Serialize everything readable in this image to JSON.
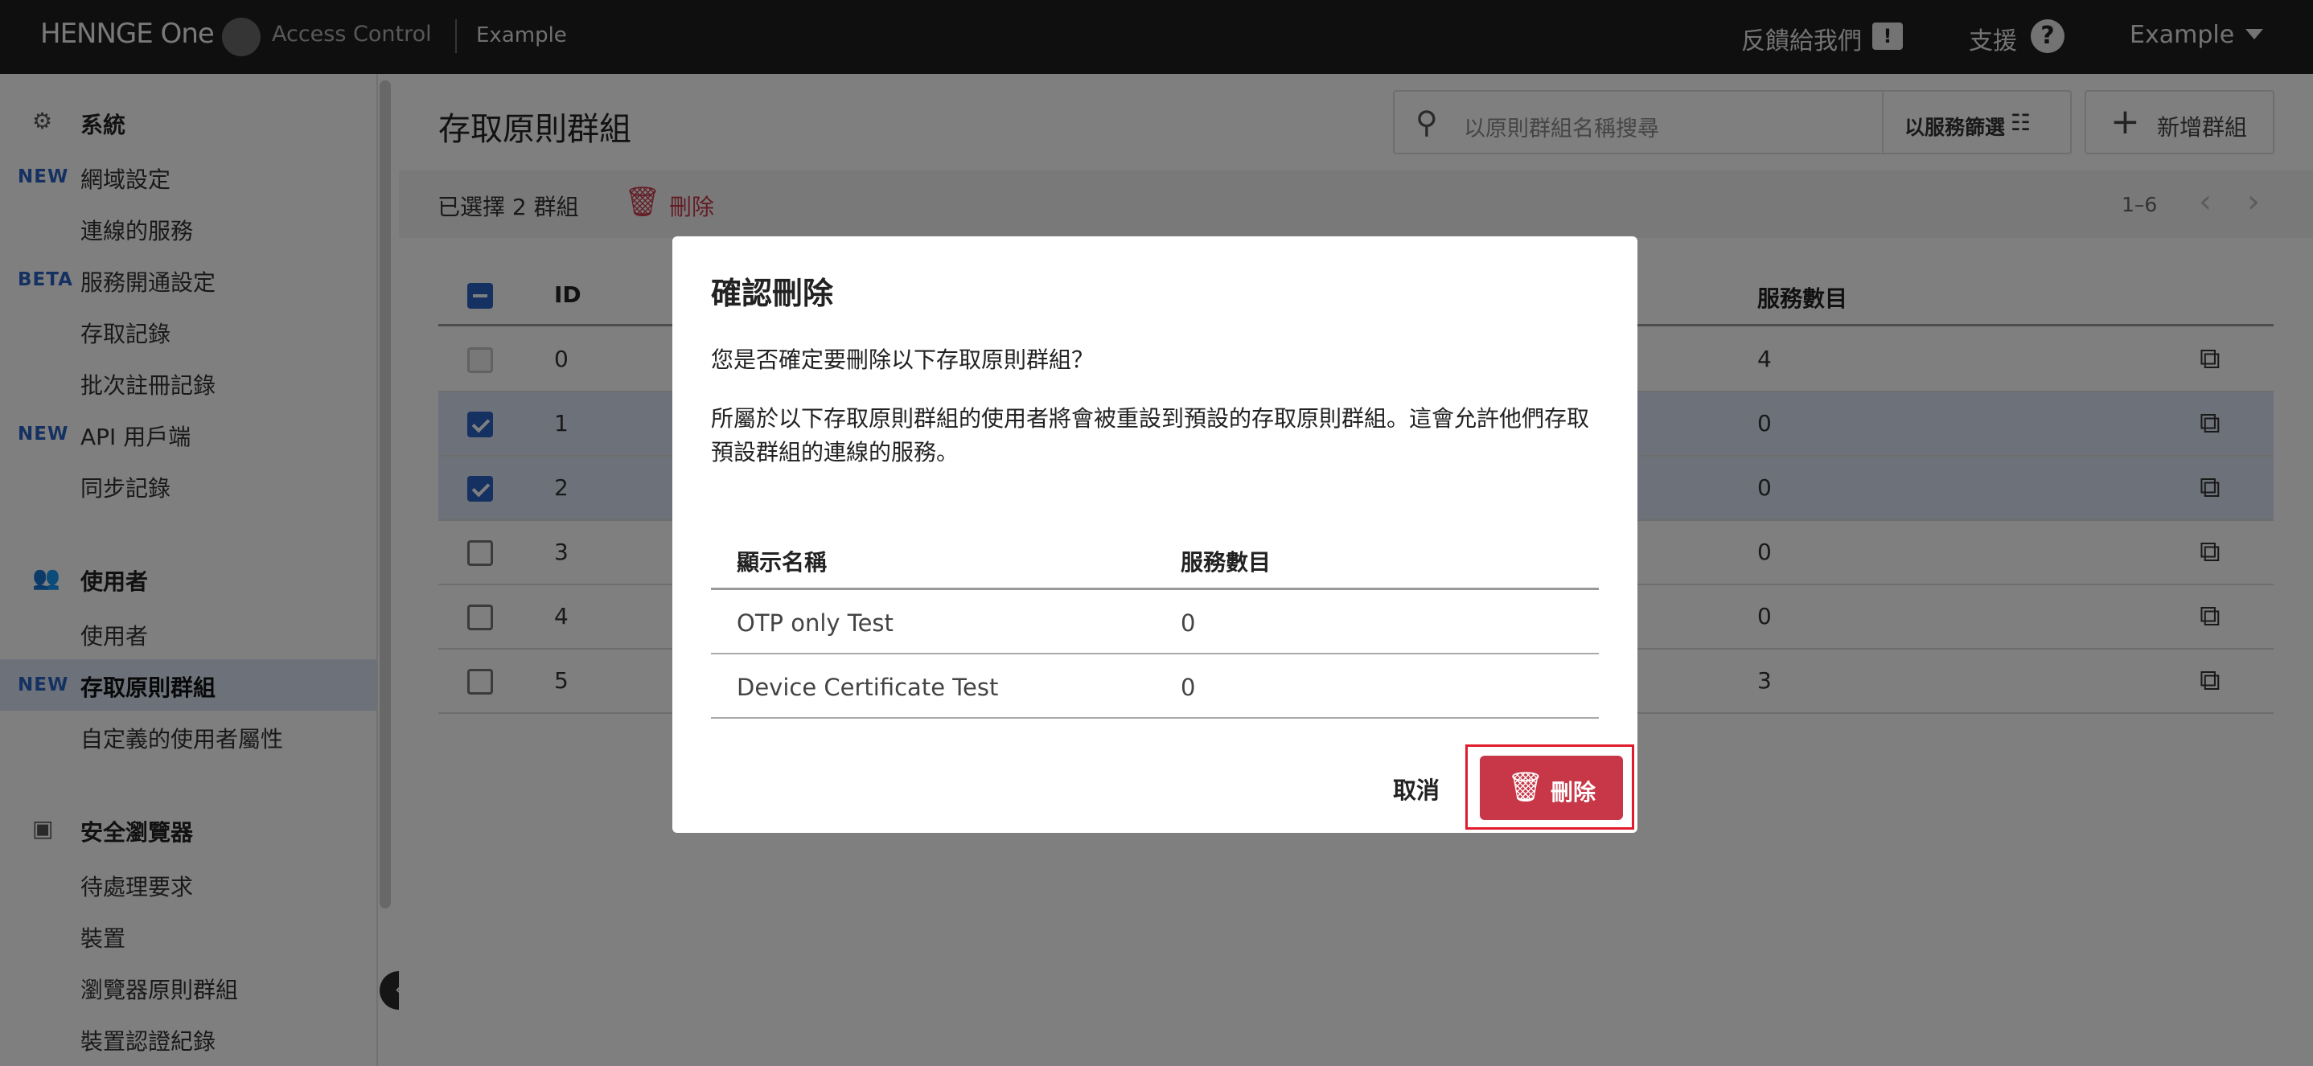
{
  "topbar": {
    "brand": "HENNGE One",
    "product": "Access Control",
    "tenant": "Example",
    "feedback_label": "反饋給我們",
    "support_label": "支援",
    "account_label": "Example"
  },
  "sidebar": {
    "sections": [
      {
        "title": "系統",
        "icon": "gear-icon"
      },
      {
        "title": "使用者",
        "icon": "users-icon"
      },
      {
        "title": "安全瀏覽器",
        "icon": "browser-icon"
      }
    ],
    "items": [
      {
        "tag": "NEW",
        "label": "網域設定"
      },
      {
        "tag": "",
        "label": "連線的服務"
      },
      {
        "tag": "BETA",
        "label": "服務開通設定"
      },
      {
        "tag": "",
        "label": "存取記錄"
      },
      {
        "tag": "",
        "label": "批次註冊記錄"
      },
      {
        "tag": "NEW",
        "label": "API 用戶端"
      },
      {
        "tag": "",
        "label": "同步記錄"
      },
      {
        "tag": "",
        "label": "使用者"
      },
      {
        "tag": "NEW",
        "label": "存取原則群組"
      },
      {
        "tag": "",
        "label": "自定義的使用者屬性"
      },
      {
        "tag": "",
        "label": "待處理要求"
      },
      {
        "tag": "",
        "label": "裝置"
      },
      {
        "tag": "",
        "label": "瀏覽器原則群組"
      },
      {
        "tag": "",
        "label": "裝置認證紀錄"
      }
    ],
    "active_item": "存取原則群組"
  },
  "main": {
    "title": "存取原則群組",
    "search_placeholder": "以原則群組名稱搜尋",
    "filter_label": "以服務篩選",
    "add_label": "新增群組",
    "selection_text": "已選擇 2 群組",
    "delete_label": "刪除",
    "pager": "1–6",
    "columns": {
      "id": "ID",
      "service_count": "服務數目"
    },
    "rows": [
      {
        "id": "0",
        "count": "4",
        "selected": false,
        "disabled": true
      },
      {
        "id": "1",
        "count": "0",
        "selected": true,
        "disabled": false
      },
      {
        "id": "2",
        "count": "0",
        "selected": true,
        "disabled": false
      },
      {
        "id": "3",
        "count": "0",
        "selected": false,
        "disabled": false
      },
      {
        "id": "4",
        "count": "0",
        "selected": false,
        "disabled": false
      },
      {
        "id": "5",
        "count": "3",
        "selected": false,
        "disabled": false
      }
    ]
  },
  "dialog": {
    "title": "確認刪除",
    "question": "您是否確定要刪除以下存取原則群組？",
    "description": "所屬於以下存取原則群組的使用者將會被重設到預設的存取原則群組。這會允許他們存取預設群組的連線的服務。",
    "columns": {
      "name": "顯示名稱",
      "count": "服務數目"
    },
    "rows": [
      {
        "name": "OTP only Test",
        "count": "0"
      },
      {
        "name": "Device Certificate Test",
        "count": "0"
      }
    ],
    "cancel_label": "取消",
    "confirm_label": "刪除"
  },
  "colors": {
    "topbar_bg": "#1f1f1f",
    "accent_blue": "#2a63c4",
    "danger_red": "#c73747",
    "highlight_frame": "#e01b2c",
    "selected_row": "#dbe5f4"
  }
}
